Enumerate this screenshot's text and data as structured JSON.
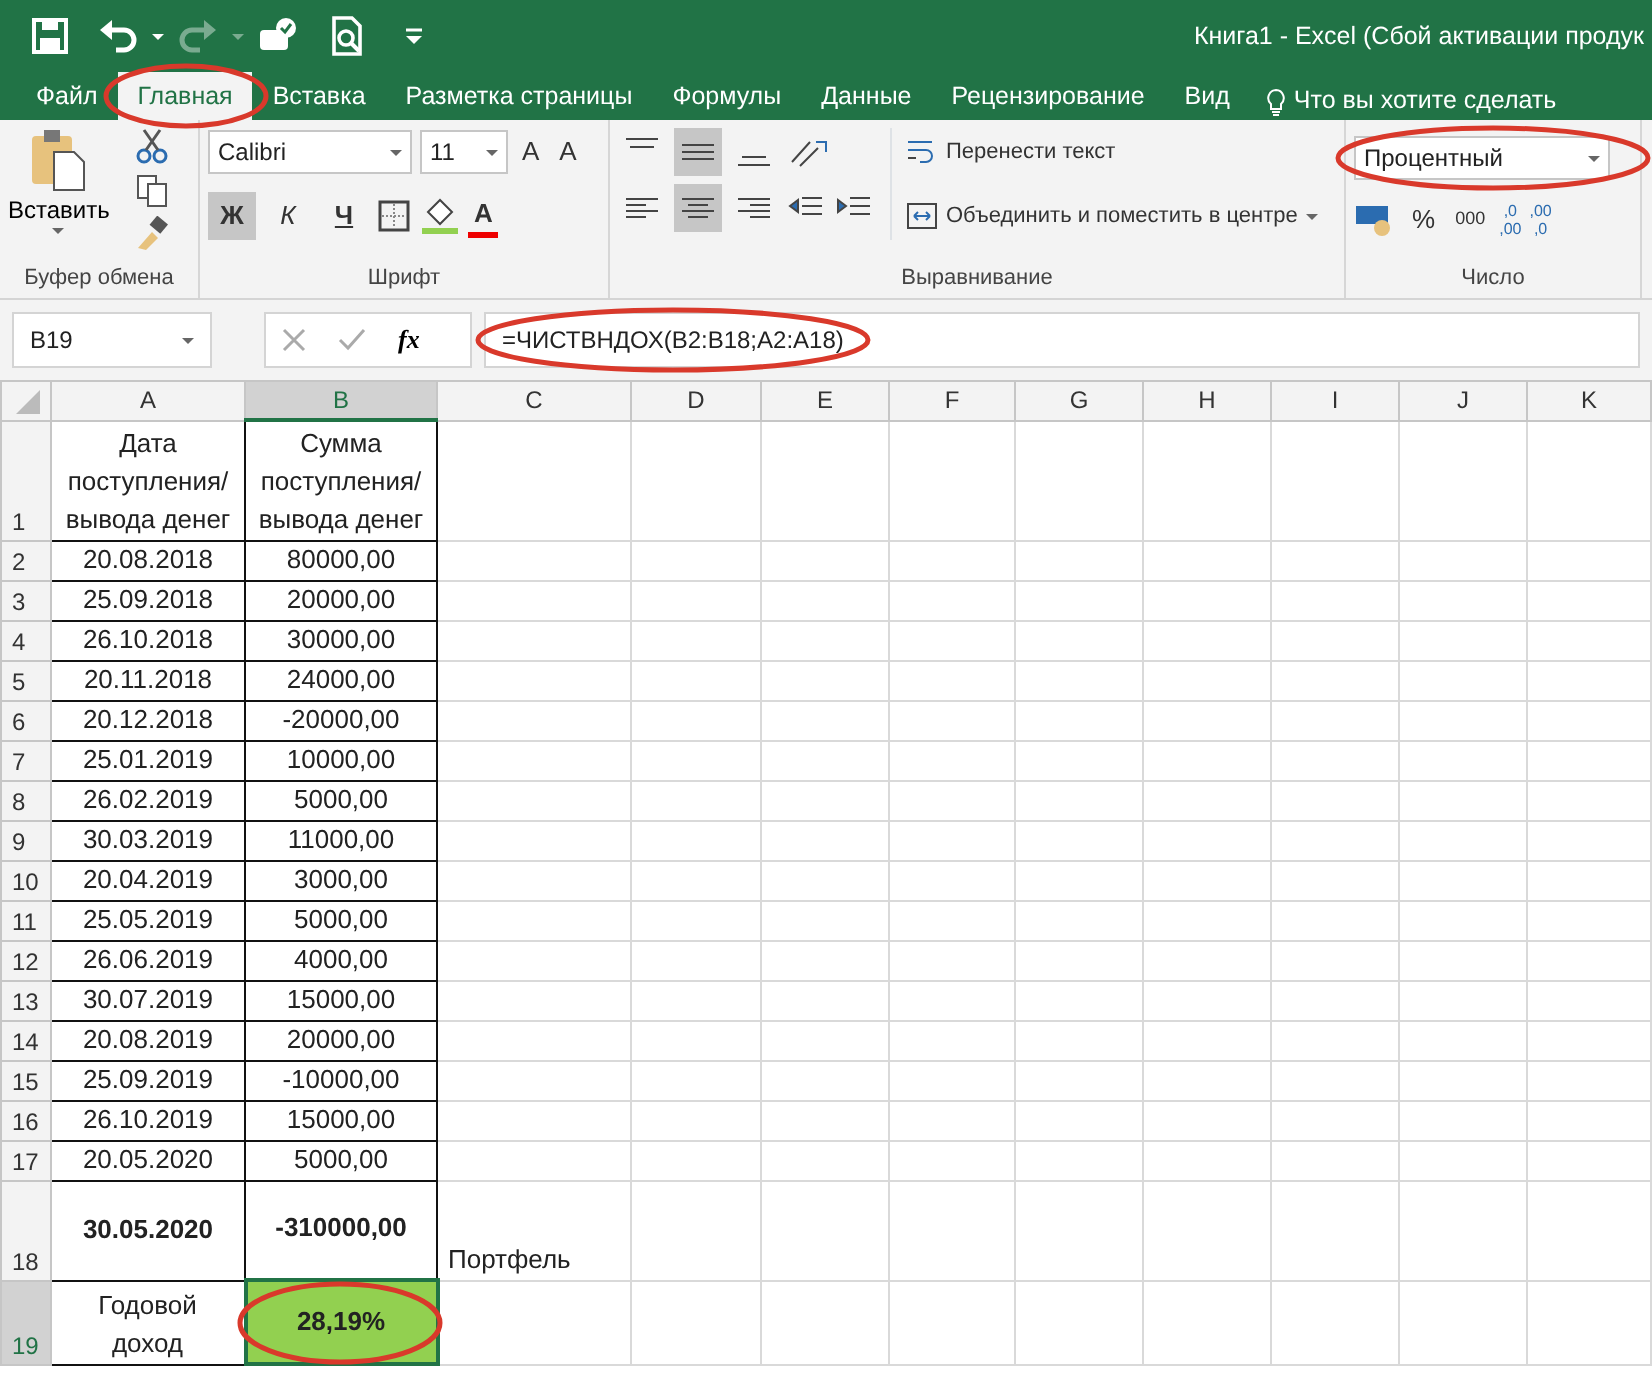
{
  "title_bar": {
    "title": "Книга1 - Excel (Сбой активации продук",
    "quick_access": [
      {
        "kind": "save",
        "disabled": false
      },
      {
        "kind": "undo",
        "disabled": false
      },
      {
        "kind": "redo",
        "disabled": true
      },
      {
        "kind": "touch",
        "disabled": false
      },
      {
        "kind": "preview",
        "disabled": false
      },
      {
        "kind": "customize",
        "disabled": false
      }
    ]
  },
  "tabs": [
    {
      "label": "Файл",
      "selected": false,
      "circled": false
    },
    {
      "label": "Главная",
      "selected": true,
      "circled": true
    },
    {
      "label": "Вставка",
      "selected": false,
      "circled": false
    },
    {
      "label": "Разметка страницы",
      "selected": false,
      "circled": false
    },
    {
      "label": "Формулы",
      "selected": false,
      "circled": false
    },
    {
      "label": "Данные",
      "selected": false,
      "circled": false
    },
    {
      "label": "Рецензирование",
      "selected": false,
      "circled": false
    },
    {
      "label": "Вид",
      "selected": false,
      "circled": false
    }
  ],
  "tell_me": "Что вы хотите сделать",
  "ribbon": {
    "clipboard": {
      "paste": "Вставить",
      "group_label": "Буфер обмена"
    },
    "font": {
      "font_name": "Calibri",
      "font_size": "11",
      "grow": "A",
      "shrink": "A",
      "styles": [
        {
          "label": "Ж",
          "kind": "bold",
          "selected": true
        },
        {
          "label": "К",
          "kind": "italic",
          "selected": false
        },
        {
          "label": "Ч",
          "kind": "underline",
          "selected": false
        }
      ],
      "font_color": "A",
      "group_label": "Шрифт"
    },
    "alignment": {
      "vertical": [
        {
          "kind": "top",
          "selected": false
        },
        {
          "kind": "middle",
          "selected": true
        },
        {
          "kind": "bottom",
          "selected": false
        }
      ],
      "horizontal": [
        {
          "kind": "left",
          "selected": false
        },
        {
          "kind": "center",
          "selected": true
        },
        {
          "kind": "right",
          "selected": false
        }
      ],
      "wrap_text": "Перенести текст",
      "merge_center": "Объединить и поместить в центре",
      "group_label": "Выравнивание"
    },
    "number": {
      "format": "Процентный",
      "circled": true,
      "percent": "%",
      "thousands": "000",
      "increase_decimal": {
        "top": ",0",
        "bottom": ",00"
      },
      "decrease_decimal": {
        "top": ",00",
        "bottom": ",0"
      },
      "group_label": "Число"
    }
  },
  "formula_bar": {
    "name_box": "B19",
    "fx": "fx",
    "formula": "=ЧИСТВНДОХ(B2:B18;A2:A18)",
    "circled": true
  },
  "sheet": {
    "columns": [
      {
        "label": "A",
        "selected": false
      },
      {
        "label": "B",
        "selected": true
      },
      {
        "label": "C",
        "selected": false
      },
      {
        "label": "D",
        "selected": false
      },
      {
        "label": "E",
        "selected": false
      },
      {
        "label": "F",
        "selected": false
      },
      {
        "label": "G",
        "selected": false
      },
      {
        "label": "H",
        "selected": false
      },
      {
        "label": "I",
        "selected": false
      },
      {
        "label": "J",
        "selected": false
      },
      {
        "label": "K",
        "selected": false
      }
    ],
    "rows": [
      {
        "number": "1",
        "kind": "header",
        "selected": false,
        "cells": [
          {
            "text": "Дата поступления/ вывода денег"
          },
          {
            "text": "Сумма поступления/ вывода денег"
          }
        ]
      },
      {
        "number": "2",
        "kind": "data",
        "selected": false,
        "cells": [
          {
            "text": "20.08.2018"
          },
          {
            "text": "80000,00"
          }
        ]
      },
      {
        "number": "3",
        "kind": "data",
        "selected": false,
        "cells": [
          {
            "text": "25.09.2018"
          },
          {
            "text": "20000,00"
          }
        ]
      },
      {
        "number": "4",
        "kind": "data",
        "selected": false,
        "cells": [
          {
            "text": "26.10.2018"
          },
          {
            "text": "30000,00"
          }
        ]
      },
      {
        "number": "5",
        "kind": "data",
        "selected": false,
        "cells": [
          {
            "text": "20.11.2018"
          },
          {
            "text": "24000,00"
          }
        ]
      },
      {
        "number": "6",
        "kind": "data",
        "selected": false,
        "cells": [
          {
            "text": "20.12.2018"
          },
          {
            "text": "-20000,00"
          }
        ]
      },
      {
        "number": "7",
        "kind": "data",
        "selected": false,
        "cells": [
          {
            "text": "25.01.2019"
          },
          {
            "text": "10000,00"
          }
        ]
      },
      {
        "number": "8",
        "kind": "data",
        "selected": false,
        "cells": [
          {
            "text": "26.02.2019"
          },
          {
            "text": "5000,00"
          }
        ]
      },
      {
        "number": "9",
        "kind": "data",
        "selected": false,
        "cells": [
          {
            "text": "30.03.2019"
          },
          {
            "text": "11000,00"
          }
        ]
      },
      {
        "number": "10",
        "kind": "data",
        "selected": false,
        "cells": [
          {
            "text": "20.04.2019"
          },
          {
            "text": "3000,00"
          }
        ]
      },
      {
        "number": "11",
        "kind": "data",
        "selected": false,
        "cells": [
          {
            "text": "25.05.2019"
          },
          {
            "text": "5000,00"
          }
        ]
      },
      {
        "number": "12",
        "kind": "data",
        "selected": false,
        "cells": [
          {
            "text": "26.06.2019"
          },
          {
            "text": "4000,00"
          }
        ]
      },
      {
        "number": "13",
        "kind": "data",
        "selected": false,
        "cells": [
          {
            "text": "30.07.2019"
          },
          {
            "text": "15000,00"
          }
        ]
      },
      {
        "number": "14",
        "kind": "data",
        "selected": false,
        "cells": [
          {
            "text": "20.08.2019"
          },
          {
            "text": "20000,00"
          }
        ]
      },
      {
        "number": "15",
        "kind": "data",
        "selected": false,
        "cells": [
          {
            "text": "25.09.2019"
          },
          {
            "text": "-10000,00"
          }
        ]
      },
      {
        "number": "16",
        "kind": "data",
        "selected": false,
        "cells": [
          {
            "text": "26.10.2019"
          },
          {
            "text": "15000,00"
          }
        ]
      },
      {
        "number": "17",
        "kind": "data",
        "selected": false,
        "cells": [
          {
            "text": "20.05.2020"
          },
          {
            "text": "5000,00"
          }
        ]
      },
      {
        "number": "18",
        "kind": "total",
        "selected": false,
        "cells": [
          {
            "text": "30.05.2020",
            "bold": true
          },
          {
            "text": "-310000,00",
            "bold": true
          },
          {
            "text": "Портфель"
          }
        ]
      },
      {
        "number": "19",
        "kind": "result",
        "selected": true,
        "cells": [
          {
            "text": "Годовой доход"
          },
          {
            "text": "28,19%",
            "bold": true,
            "fill": true,
            "circled": true
          }
        ]
      }
    ]
  }
}
